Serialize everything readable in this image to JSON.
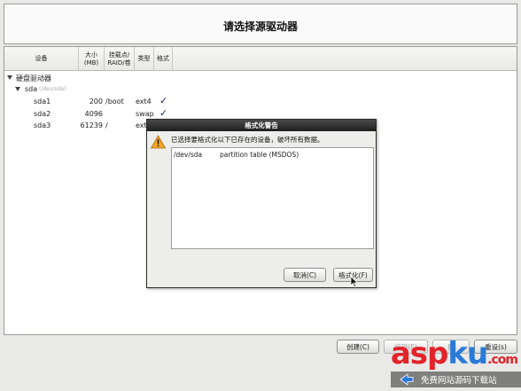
{
  "header": {
    "title": "请选择源驱动器"
  },
  "table": {
    "columns": [
      {
        "key": "device",
        "label": "设备"
      },
      {
        "key": "size",
        "label": "大小\n(MB)"
      },
      {
        "key": "mount",
        "label": "挂载点/\nRAID/卷"
      },
      {
        "key": "type",
        "label": "类型"
      },
      {
        "key": "format",
        "label": "格式"
      }
    ],
    "group": {
      "label": "硬盘驱动器"
    },
    "disk": {
      "name": "sda",
      "path": "(/dev/sda)"
    },
    "partitions": [
      {
        "device": "sda1",
        "size": "200",
        "mount": "/boot",
        "type": "ext4",
        "format": "✓"
      },
      {
        "device": "sda2",
        "size": "4096",
        "mount": "",
        "type": "swap",
        "format": "✓"
      },
      {
        "device": "sda3",
        "size": "61239",
        "mount": "/",
        "type": "ext",
        "format": ""
      }
    ]
  },
  "buttons": {
    "create": "创建(C)",
    "edit": "编辑(E)",
    "delete": "删",
    "reset": "重设(s)"
  },
  "dialog": {
    "title": "格式化警告",
    "message": "已选择要格式化以下已存在的设备，破坏所有数据。",
    "items": [
      {
        "device": "/dev/sda",
        "description": "partition table (MSDOS)"
      }
    ],
    "cancel": "取消(C)",
    "format": "格式化(F)"
  },
  "watermark": {
    "text_asp": "asp",
    "text_ku": "ku",
    "text_com": ".com",
    "sub": "免费网站源码下载站"
  },
  "icons": {
    "warning": "warning-icon",
    "expand": "triangle-down-icon",
    "pointer": "mouse-pointer-icon"
  },
  "colors": {
    "check": "#1a2a6a",
    "warning": "#f5a623",
    "watermark_red": "#e2232a",
    "watermark_blue": "#2a7ad8"
  }
}
